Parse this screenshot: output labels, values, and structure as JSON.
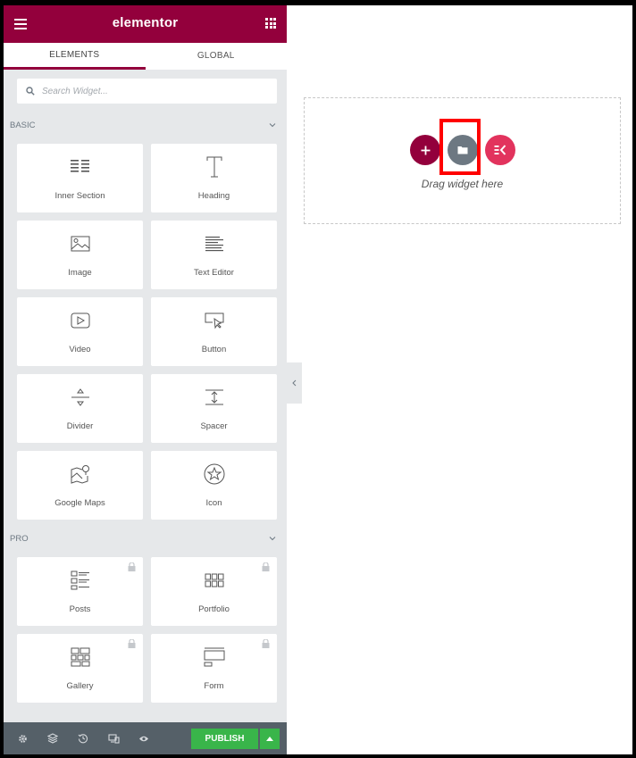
{
  "app": {
    "brand": "elementor"
  },
  "tabs": [
    {
      "label": "ELEMENTS"
    },
    {
      "label": "GLOBAL"
    }
  ],
  "search": {
    "placeholder": "Search Widget..."
  },
  "categories": {
    "basic": {
      "label": "BASIC",
      "widgets": [
        {
          "label": "Inner Section",
          "icon": "inner-section-icon"
        },
        {
          "label": "Heading",
          "icon": "heading-icon"
        },
        {
          "label": "Image",
          "icon": "image-icon"
        },
        {
          "label": "Text Editor",
          "icon": "text-editor-icon"
        },
        {
          "label": "Video",
          "icon": "video-icon"
        },
        {
          "label": "Button",
          "icon": "button-icon"
        },
        {
          "label": "Divider",
          "icon": "divider-icon"
        },
        {
          "label": "Spacer",
          "icon": "spacer-icon"
        },
        {
          "label": "Google Maps",
          "icon": "google-maps-icon"
        },
        {
          "label": "Icon",
          "icon": "star-icon"
        }
      ]
    },
    "pro": {
      "label": "PRO",
      "widgets": [
        {
          "label": "Posts",
          "icon": "posts-icon",
          "locked": true
        },
        {
          "label": "Portfolio",
          "icon": "portfolio-icon",
          "locked": true
        },
        {
          "label": "Gallery",
          "icon": "gallery-icon",
          "locked": true
        },
        {
          "label": "Form",
          "icon": "form-icon",
          "locked": true
        }
      ]
    }
  },
  "footer": {
    "publish_label": "PUBLISH"
  },
  "canvas": {
    "drop_text": "Drag widget here"
  },
  "colors": {
    "brand": "#93003c",
    "publish": "#39b54a",
    "panel": "#e6e8ea",
    "footer": "#556068",
    "highlight": "#ff0000"
  }
}
